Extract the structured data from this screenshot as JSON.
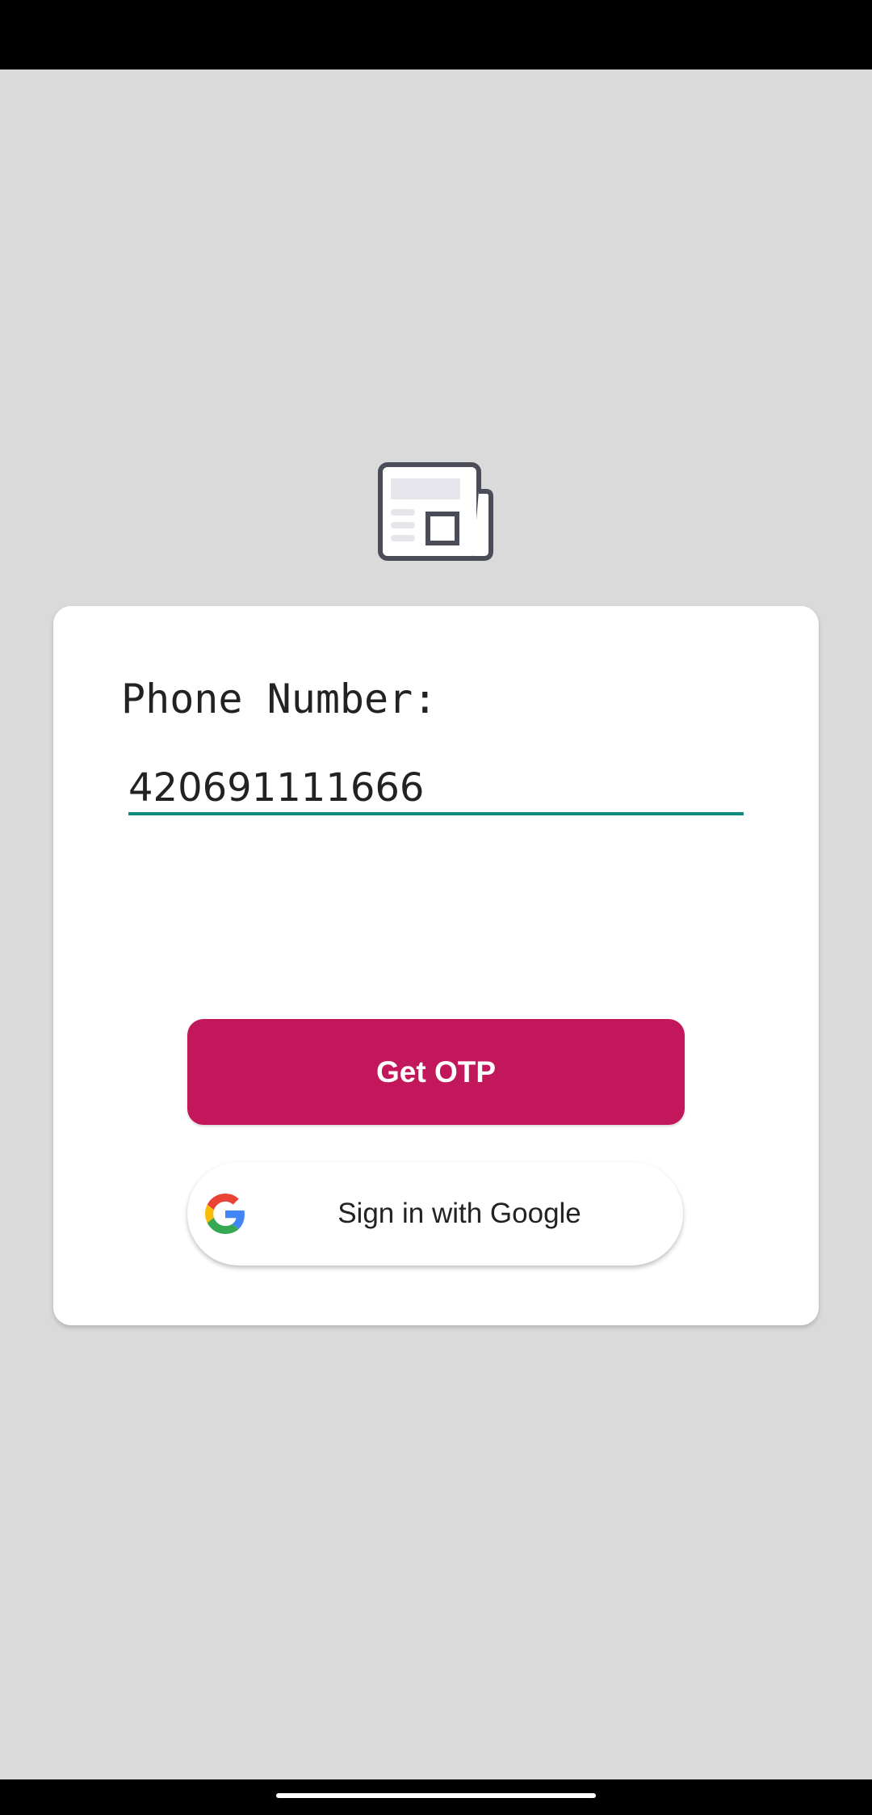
{
  "logo": {
    "icon": "newspaper-icon"
  },
  "form": {
    "phone_label": "Phone Number:",
    "phone_value": "420691111666"
  },
  "buttons": {
    "otp_label": "Get OTP",
    "google_label": "Sign in with Google",
    "google_icon": "google-g-icon"
  },
  "colors": {
    "background": "#dadada",
    "accent": "#c2185b",
    "input_underline": "#0f8a7e",
    "card": "#ffffff"
  }
}
